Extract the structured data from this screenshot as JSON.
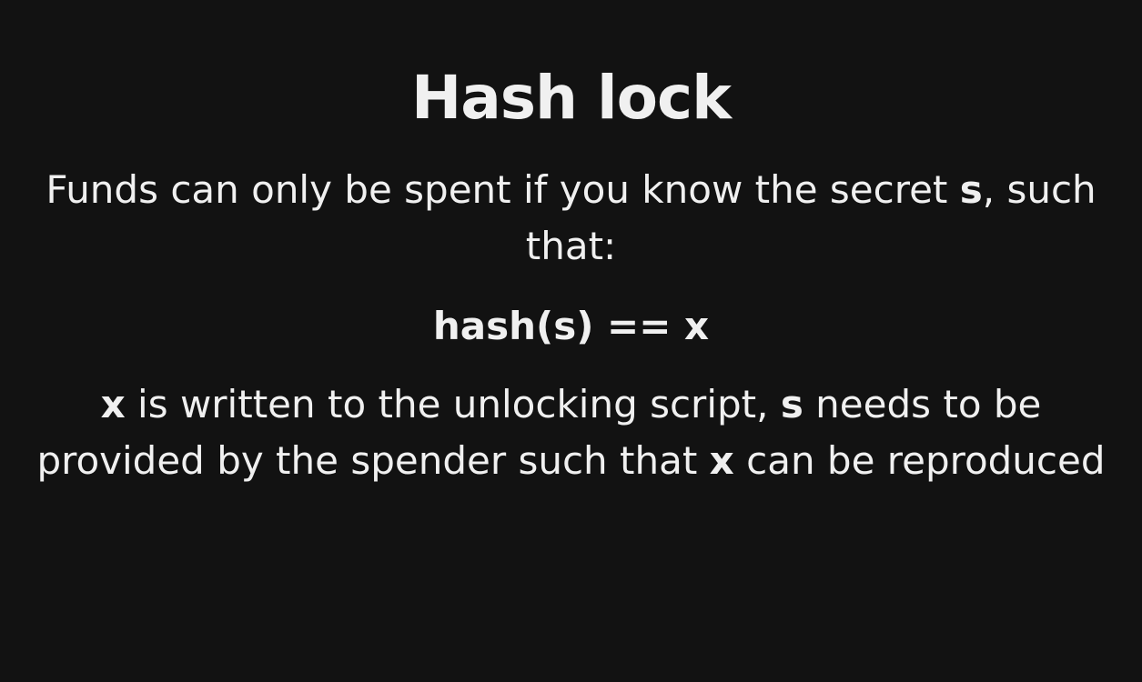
{
  "slide": {
    "title": "Hash lock",
    "line1": {
      "before": "Funds can only be spent if you know the secret ",
      "bold": "s",
      "after": ", such that:"
    },
    "formula": "hash(s) == x",
    "line2": {
      "bold1": "x",
      "text1": " is written to the unlocking script, ",
      "bold2": "s",
      "text2": " needs to be provided by the spender such that ",
      "bold3": "x",
      "text3": " can be reproduced"
    }
  }
}
